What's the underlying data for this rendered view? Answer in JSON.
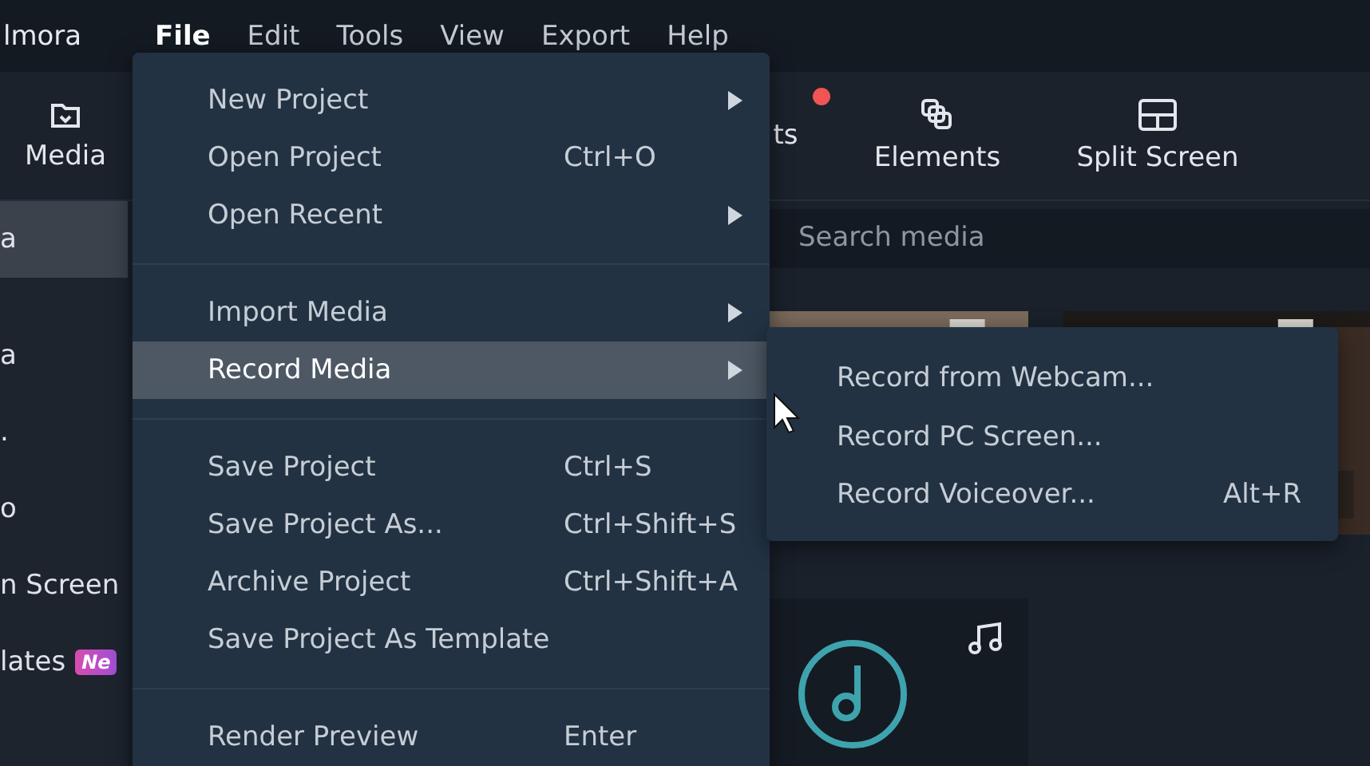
{
  "app_title": "lmora",
  "menu_bar": [
    {
      "label": "File",
      "selected": true
    },
    {
      "label": "Edit",
      "selected": false
    },
    {
      "label": "Tools",
      "selected": false
    },
    {
      "label": "View",
      "selected": false
    },
    {
      "label": "Export",
      "selected": false
    },
    {
      "label": "Help",
      "selected": false
    }
  ],
  "toolbar": {
    "tabs": [
      {
        "label": "Media",
        "kind": "import",
        "notification": false
      },
      {
        "label": "ts",
        "kind": "plain",
        "notification": true
      },
      {
        "label": "Elements",
        "kind": "elements",
        "notification": false
      },
      {
        "label": "Split Screen",
        "kind": "split",
        "notification": false
      }
    ]
  },
  "sidebar": {
    "items": [
      {
        "label": "a",
        "selected": true
      },
      {
        "label": "a",
        "selected": false
      },
      {
        "label": ".",
        "selected": false
      },
      {
        "label": "o",
        "selected": false
      },
      {
        "label": "n Screen",
        "selected": false
      },
      {
        "label": "lates",
        "selected": false,
        "badge": "Ne"
      }
    ]
  },
  "search": {
    "placeholder": "Search media"
  },
  "media": [
    {
      "kind": "picture"
    },
    {
      "kind": "picture"
    },
    {
      "kind": "audio"
    }
  ],
  "file_menu": {
    "sections": [
      [
        {
          "label": "New Project",
          "submenu": true,
          "highlighted": false
        },
        {
          "label": "Open Project",
          "shortcut": "Ctrl+O",
          "submenu": false,
          "highlighted": false
        },
        {
          "label": "Open Recent",
          "submenu": true,
          "highlighted": false
        }
      ],
      [
        {
          "label": "Import Media",
          "submenu": true,
          "highlighted": false
        },
        {
          "label": "Record Media",
          "submenu": true,
          "highlighted": true
        }
      ],
      [
        {
          "label": "Save Project",
          "shortcut": "Ctrl+S",
          "submenu": false,
          "highlighted": false
        },
        {
          "label": "Save Project As...",
          "shortcut": "Ctrl+Shift+S",
          "submenu": false,
          "highlighted": false
        },
        {
          "label": "Archive Project",
          "shortcut": "Ctrl+Shift+A",
          "submenu": false,
          "highlighted": false
        },
        {
          "label": "Save Project As Template",
          "submenu": false,
          "highlighted": false
        }
      ],
      [
        {
          "label": "Render Preview",
          "shortcut": "Enter",
          "submenu": false,
          "highlighted": false
        }
      ]
    ]
  },
  "record_submenu": [
    {
      "label": "Record from Webcam..."
    },
    {
      "label": "Record PC Screen..."
    },
    {
      "label": "Record Voiceover...",
      "shortcut": "Alt+R"
    }
  ]
}
